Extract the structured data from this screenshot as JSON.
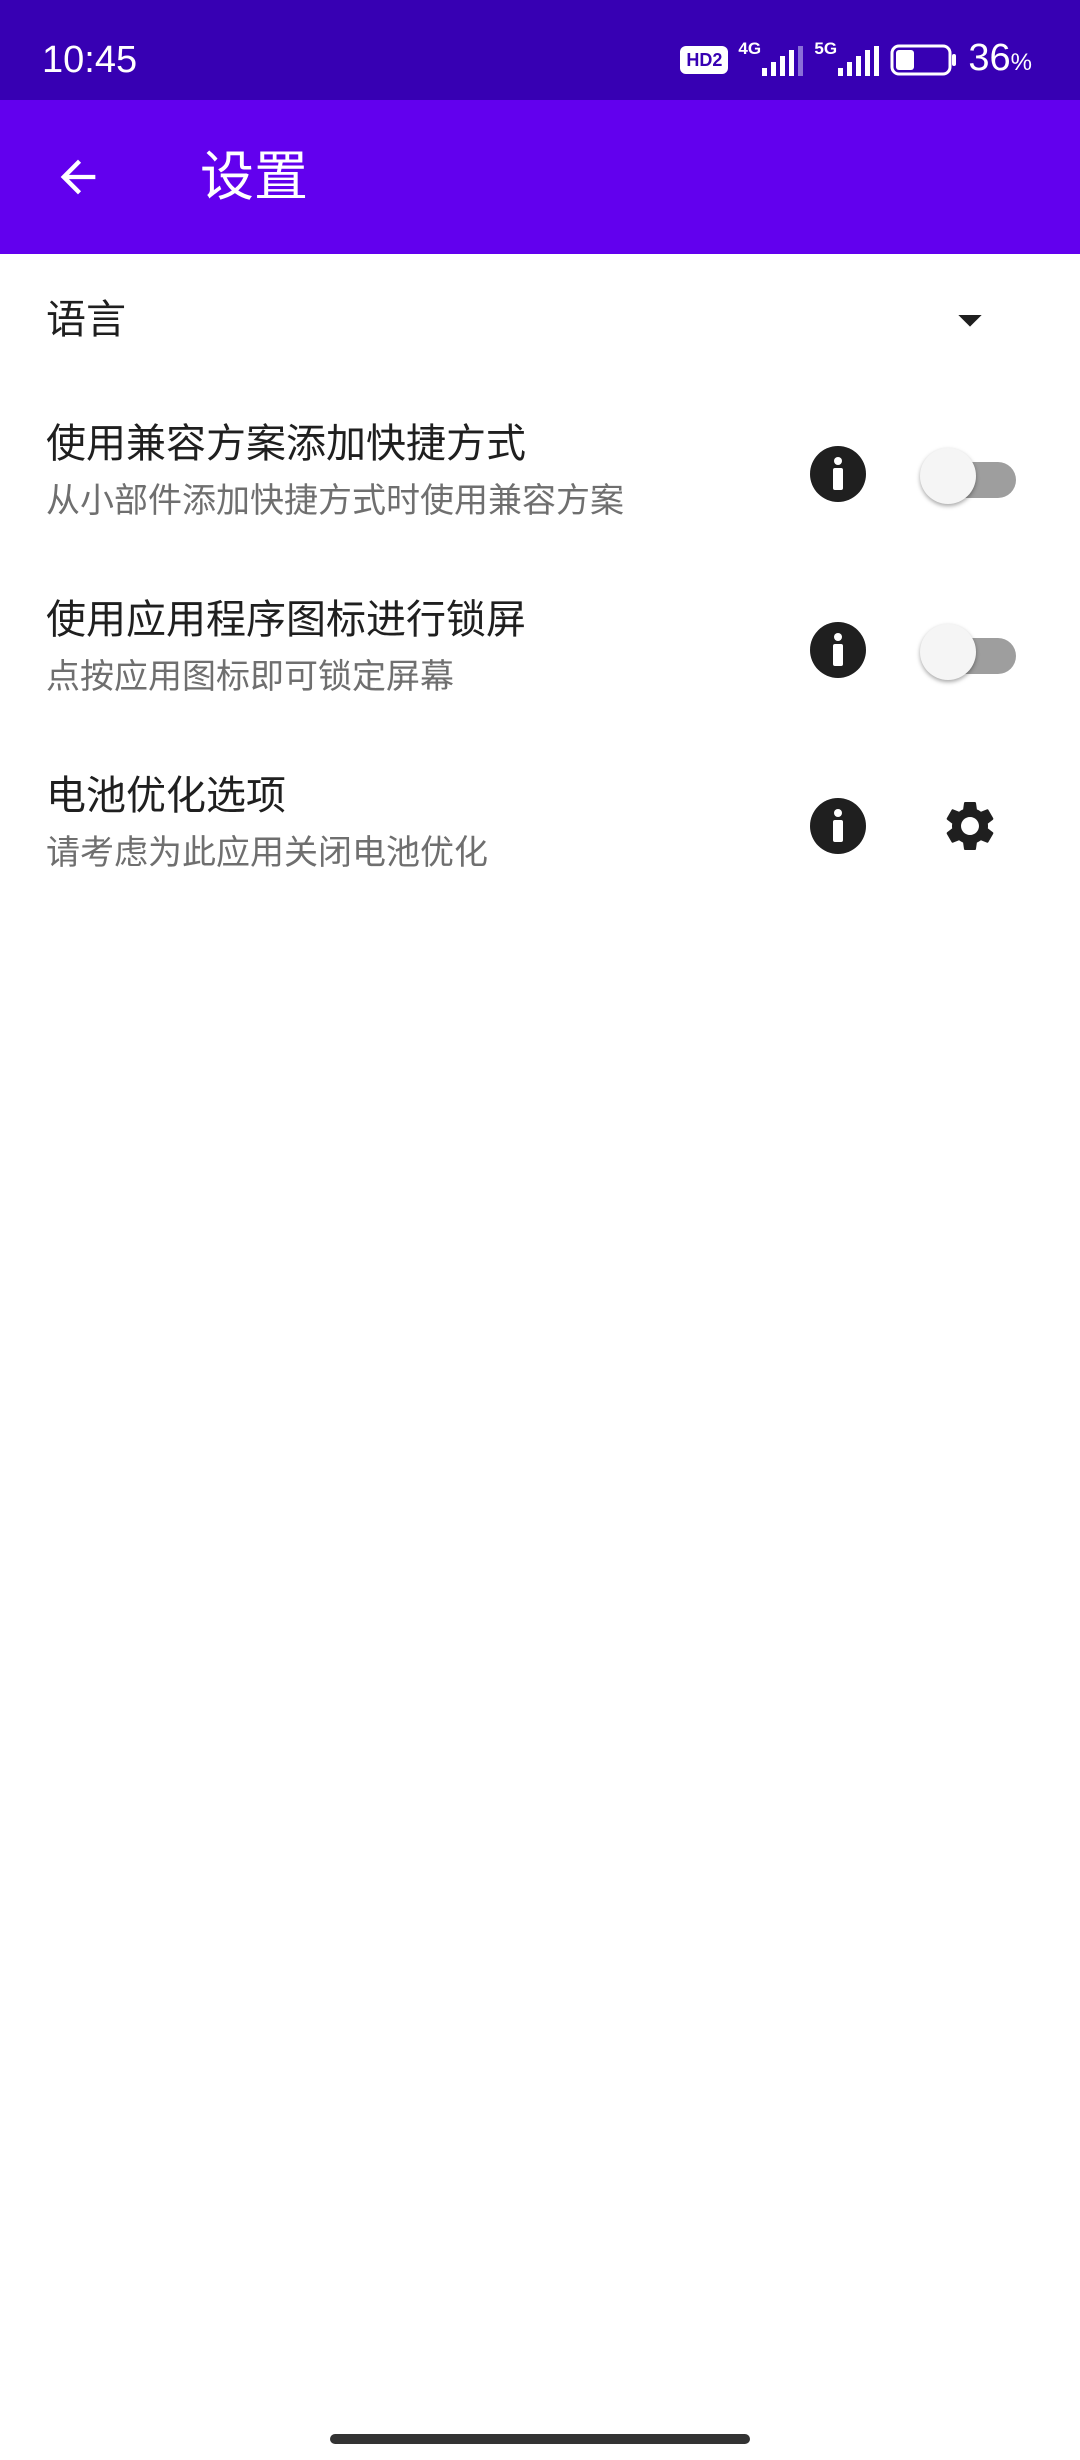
{
  "status_bar": {
    "time": "10:45",
    "hd_badge": "HD2",
    "network_1": "4G",
    "network_2": "5G",
    "battery_percent": "36",
    "battery_unit": "%",
    "battery_level": 0.36
  },
  "app_bar": {
    "title": "设置",
    "back_icon": "arrow-back-icon",
    "background_color": "#6200EE",
    "status_color": "#3700B3"
  },
  "settings": {
    "language": {
      "title": "语言",
      "control_icon": "dropdown-arrow-icon"
    },
    "compat_shortcut": {
      "title": "使用兼容方案添加快捷方式",
      "subtitle": "从小部件添加快捷方式时使用兼容方案",
      "enabled": false
    },
    "icon_lock": {
      "title": "使用应用程序图标进行锁屏",
      "subtitle": "点按应用图标即可锁定屏幕",
      "enabled": false
    },
    "battery_opt": {
      "title": "电池优化选项",
      "subtitle": "请考虑为此应用关闭电池优化",
      "control_icon": "gear-icon"
    }
  }
}
